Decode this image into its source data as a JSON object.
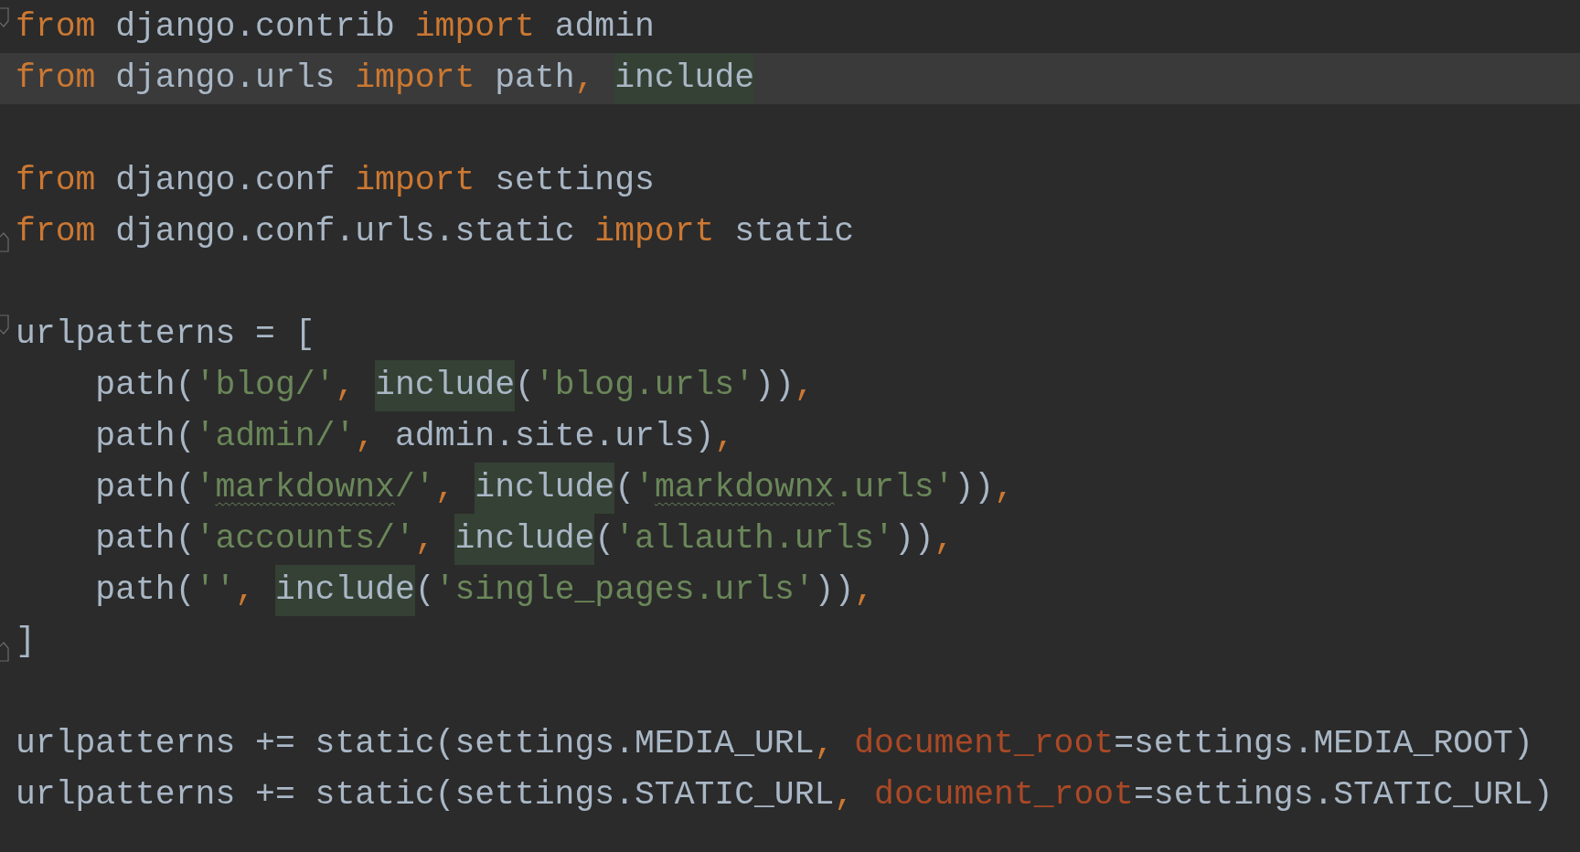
{
  "lines": [
    {
      "current": false,
      "fold": {
        "kind": "start"
      },
      "tokens": [
        {
          "text": "from",
          "kind": "keyword"
        },
        {
          "text": " django.contrib ",
          "kind": "name"
        },
        {
          "text": "import",
          "kind": "keyword"
        },
        {
          "text": " admin",
          "kind": "name"
        }
      ]
    },
    {
      "current": true,
      "tokens": [
        {
          "text": "from",
          "kind": "keyword"
        },
        {
          "text": " django.urls ",
          "kind": "name"
        },
        {
          "text": "import",
          "kind": "keyword"
        },
        {
          "text": " path",
          "kind": "name"
        },
        {
          "text": ", ",
          "kind": "punct"
        },
        {
          "text": "include",
          "kind": "usage"
        }
      ]
    },
    {
      "current": false
    },
    {
      "current": false,
      "tokens": [
        {
          "text": "from",
          "kind": "keyword"
        },
        {
          "text": " django.conf ",
          "kind": "name"
        },
        {
          "text": "import",
          "kind": "keyword"
        },
        {
          "text": " settings",
          "kind": "name"
        }
      ]
    },
    {
      "current": false,
      "fold": {
        "kind": "end"
      },
      "tokens": [
        {
          "text": "from",
          "kind": "keyword"
        },
        {
          "text": " django.conf.urls.static ",
          "kind": "name"
        },
        {
          "text": "import",
          "kind": "keyword"
        },
        {
          "text": " static",
          "kind": "name"
        }
      ]
    },
    {
      "current": false
    },
    {
      "current": false,
      "fold": {
        "kind": "start"
      },
      "tokens": [
        {
          "text": "urlpatterns = [",
          "kind": "name"
        }
      ]
    },
    {
      "current": false,
      "tokens": [
        {
          "text": "    path(",
          "kind": "name"
        },
        {
          "text": "'blog/'",
          "kind": "string"
        },
        {
          "text": ", ",
          "kind": "punct"
        },
        {
          "text": "include",
          "kind": "usage"
        },
        {
          "text": "(",
          "kind": "name"
        },
        {
          "text": "'blog.urls'",
          "kind": "string"
        },
        {
          "text": "))",
          "kind": "name"
        },
        {
          "text": ",",
          "kind": "punct"
        }
      ]
    },
    {
      "current": false,
      "tokens": [
        {
          "text": "    path(",
          "kind": "name"
        },
        {
          "text": "'admin/'",
          "kind": "string"
        },
        {
          "text": ", ",
          "kind": "punct"
        },
        {
          "text": "admin.site.urls)",
          "kind": "name"
        },
        {
          "text": ",",
          "kind": "punct"
        }
      ]
    },
    {
      "current": false,
      "tokens": [
        {
          "text": "    path(",
          "kind": "name"
        },
        {
          "text": "'",
          "kind": "string"
        },
        {
          "text": "markdownx",
          "kind": "typo"
        },
        {
          "text": "/'",
          "kind": "string"
        },
        {
          "text": ", ",
          "kind": "punct"
        },
        {
          "text": "include",
          "kind": "usage"
        },
        {
          "text": "(",
          "kind": "name"
        },
        {
          "text": "'",
          "kind": "string"
        },
        {
          "text": "markdownx",
          "kind": "typo"
        },
        {
          "text": ".urls'",
          "kind": "string"
        },
        {
          "text": "))",
          "kind": "name"
        },
        {
          "text": ",",
          "kind": "punct"
        }
      ]
    },
    {
      "current": false,
      "tokens": [
        {
          "text": "    path(",
          "kind": "name"
        },
        {
          "text": "'accounts/'",
          "kind": "string"
        },
        {
          "text": ", ",
          "kind": "punct"
        },
        {
          "text": "include",
          "kind": "usage"
        },
        {
          "text": "(",
          "kind": "name"
        },
        {
          "text": "'allauth.urls'",
          "kind": "string"
        },
        {
          "text": "))",
          "kind": "name"
        },
        {
          "text": ",",
          "kind": "punct"
        }
      ]
    },
    {
      "current": false,
      "tokens": [
        {
          "text": "    path(",
          "kind": "name"
        },
        {
          "text": "''",
          "kind": "string"
        },
        {
          "text": ", ",
          "kind": "punct"
        },
        {
          "text": "include",
          "kind": "usage"
        },
        {
          "text": "(",
          "kind": "name"
        },
        {
          "text": "'single_pages.urls'",
          "kind": "string"
        },
        {
          "text": "))",
          "kind": "name"
        },
        {
          "text": ",",
          "kind": "punct"
        }
      ]
    },
    {
      "current": false,
      "fold": {
        "kind": "end"
      },
      "tokens": [
        {
          "text": "]",
          "kind": "name"
        }
      ]
    },
    {
      "current": false
    },
    {
      "current": false,
      "tokens": [
        {
          "text": "urlpatterns += static(settings.MEDIA_URL",
          "kind": "name"
        },
        {
          "text": ", ",
          "kind": "punct"
        },
        {
          "text": "document_root",
          "kind": "param"
        },
        {
          "text": "=settings.MEDIA_ROOT)",
          "kind": "name"
        }
      ]
    },
    {
      "current": false,
      "tokens": [
        {
          "text": "urlpatterns += static(settings.STATIC_URL",
          "kind": "name"
        },
        {
          "text": ", ",
          "kind": "punct"
        },
        {
          "text": "document_root",
          "kind": "param"
        },
        {
          "text": "=settings.STATIC_URL)",
          "kind": "name"
        }
      ]
    }
  ]
}
